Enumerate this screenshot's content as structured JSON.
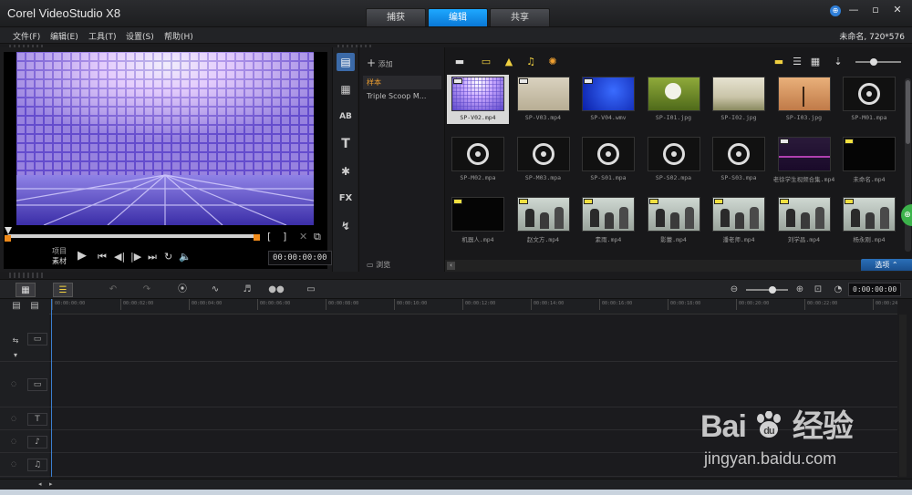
{
  "app": {
    "title": "Corel VideoStudio X8",
    "modes": [
      {
        "label": "捕获",
        "active": false
      },
      {
        "label": "编辑",
        "active": true
      },
      {
        "label": "共享",
        "active": false
      }
    ],
    "project_info": "未命名, 720*576"
  },
  "menu": [
    {
      "label": "文件(F)"
    },
    {
      "label": "编辑(E)"
    },
    {
      "label": "工具(T)"
    },
    {
      "label": "设置(S)"
    },
    {
      "label": "帮助(H)"
    }
  ],
  "player": {
    "mode_project": "项目",
    "mode_clip": "素材",
    "timecode": "00:00:00:00"
  },
  "library": {
    "add_label": "添加",
    "browse_label": "浏览",
    "options_label": "选项",
    "folders": [
      {
        "label": "样本",
        "active": true
      },
      {
        "label": "Triple Scoop M...",
        "active": false
      }
    ],
    "thumbs": [
      {
        "name": "SP-V02.mp4",
        "kind": "tiles",
        "selected": true
      },
      {
        "name": "SP-V03.mp4",
        "kind": "beige"
      },
      {
        "name": "SP-V04.wmv",
        "kind": "blue"
      },
      {
        "name": "SP-I01.jpg",
        "kind": "dandelion"
      },
      {
        "name": "SP-I02.jpg",
        "kind": "landscape"
      },
      {
        "name": "SP-I03.jpg",
        "kind": "tree"
      },
      {
        "name": "SP-M01.mpa",
        "kind": "audio"
      },
      {
        "name": "SP-M02.mpa",
        "kind": "audio"
      },
      {
        "name": "SP-M03.mpa",
        "kind": "audio"
      },
      {
        "name": "SP-S01.mpa",
        "kind": "audio"
      },
      {
        "name": "SP-S02.mpa",
        "kind": "audio"
      },
      {
        "name": "SP-S03.mpa",
        "kind": "audio"
      },
      {
        "name": "老徐学生视频合集.mp4",
        "kind": "dark"
      },
      {
        "name": "未命名.mp4",
        "kind": "black"
      },
      {
        "name": "机器人.mp4",
        "kind": "black"
      },
      {
        "name": "赵文方.mp4",
        "kind": "classroom"
      },
      {
        "name": "素雨.mp4",
        "kind": "classroom"
      },
      {
        "name": "影蕾.mp4",
        "kind": "classroom"
      },
      {
        "name": "潘老师.mp4",
        "kind": "classroom"
      },
      {
        "name": "刘学昌.mp4",
        "kind": "classroom"
      },
      {
        "name": "杨永刚.mp4",
        "kind": "classroom"
      }
    ]
  },
  "timeline": {
    "timecode": "0:00:00:00",
    "ruler": [
      "00:00:00:00",
      "00:00:02:00",
      "00:00:04:00",
      "00:00:06:00",
      "00:00:08:00",
      "00:00:10:00",
      "00:00:12:00",
      "00:00:14:00",
      "00:00:16:00",
      "00:00:18:00",
      "00:00:20:00",
      "00:00:22:00",
      "00:00:24"
    ]
  },
  "watermark": {
    "logo_left": "Bai",
    "logo_right": "经验",
    "url": "jingyan.baidu.com"
  }
}
